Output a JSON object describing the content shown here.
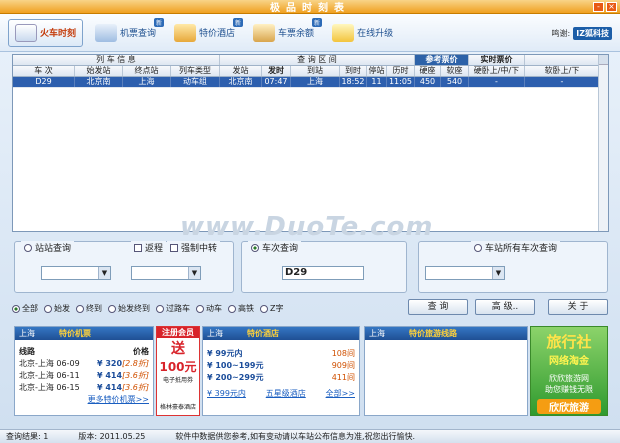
{
  "window": {
    "title": "极品时刻表"
  },
  "toolbar": {
    "items": [
      {
        "label": "火车时刻",
        "badge": ""
      },
      {
        "label": "机票查询",
        "badge": "新"
      },
      {
        "label": "特价酒店",
        "badge": "新"
      },
      {
        "label": "车票余额",
        "badge": "新"
      },
      {
        "label": "在线升级",
        "badge": ""
      }
    ],
    "brand_prefix": "鸣谢:",
    "brand": "IZ狐科技"
  },
  "table": {
    "group_headers": [
      "列 车 信 息",
      "查 询 区 间",
      "参考票价",
      "实时票价"
    ],
    "columns": [
      "车 次",
      "始发站",
      "终点站",
      "列车类型",
      "发站",
      "发时",
      "到站",
      "到时",
      "停站",
      "历时",
      "硬座",
      "软座",
      "硬卧上/中/下",
      "软卧上/下"
    ],
    "rows": [
      [
        "D29",
        "北京南",
        "上海",
        "动车组",
        "北京南",
        "07:47",
        "上海",
        "18:52",
        "11",
        "11:05",
        "450",
        "540",
        "-",
        "-"
      ]
    ]
  },
  "watermark": "www.DuoTe.com",
  "query": {
    "station_label": "站站查询",
    "roundtrip": "返程",
    "force_transfer": "强制中转",
    "train_label": "车次查询",
    "train_value": "D29",
    "all_trains_label": "车站所有车次查询"
  },
  "filters": [
    "全部",
    "始发",
    "终到",
    "始发终到",
    "过路车",
    "动车",
    "高铁",
    "Z字"
  ],
  "buttons": {
    "query": "查 询",
    "advanced": "高 级..",
    "close": "关 于"
  },
  "ads": {
    "flights": {
      "city": "上海",
      "title": "特价机票",
      "col1": "线路",
      "col2": "价格",
      "rows": [
        [
          "北京-上海 06-09",
          "¥ 320",
          "[2.8折]"
        ],
        [
          "北京-上海 06-11",
          "¥ 414",
          "[3.6折]"
        ],
        [
          "北京-上海 06-15",
          "¥ 414",
          "[3.6折]"
        ]
      ],
      "more": "更多特价机票>>"
    },
    "member": {
      "top": "注册会员",
      "send": "送",
      "amount": "100元",
      "sub": "电子抵用券",
      "foot": "格林豪泰酒店"
    },
    "hotels": {
      "city": "上海",
      "title": "特价酒店",
      "rows": [
        [
          "¥ 99元内",
          "108间"
        ],
        [
          "¥ 100~199元",
          "909间"
        ],
        [
          "¥ 200~299元",
          "411间"
        ]
      ],
      "links": [
        "¥ 399元内",
        "五星级酒店",
        "全部>>"
      ]
    },
    "tours": {
      "city": "上海",
      "title": "特价旅游线路"
    },
    "agency": {
      "line1": "旅行社",
      "line2": "网络淘金",
      "line3": "欣欣旅游网",
      "line4": "助您赚钱无限",
      "logo": "欣欣旅游"
    }
  },
  "status": {
    "count_label": "查询结果:",
    "count": "1",
    "version_label": "版本:",
    "version": "2011.05.25",
    "note": "软件中数据供您参考,如有变动请以车站公布信息为准,祝您出行愉快."
  }
}
